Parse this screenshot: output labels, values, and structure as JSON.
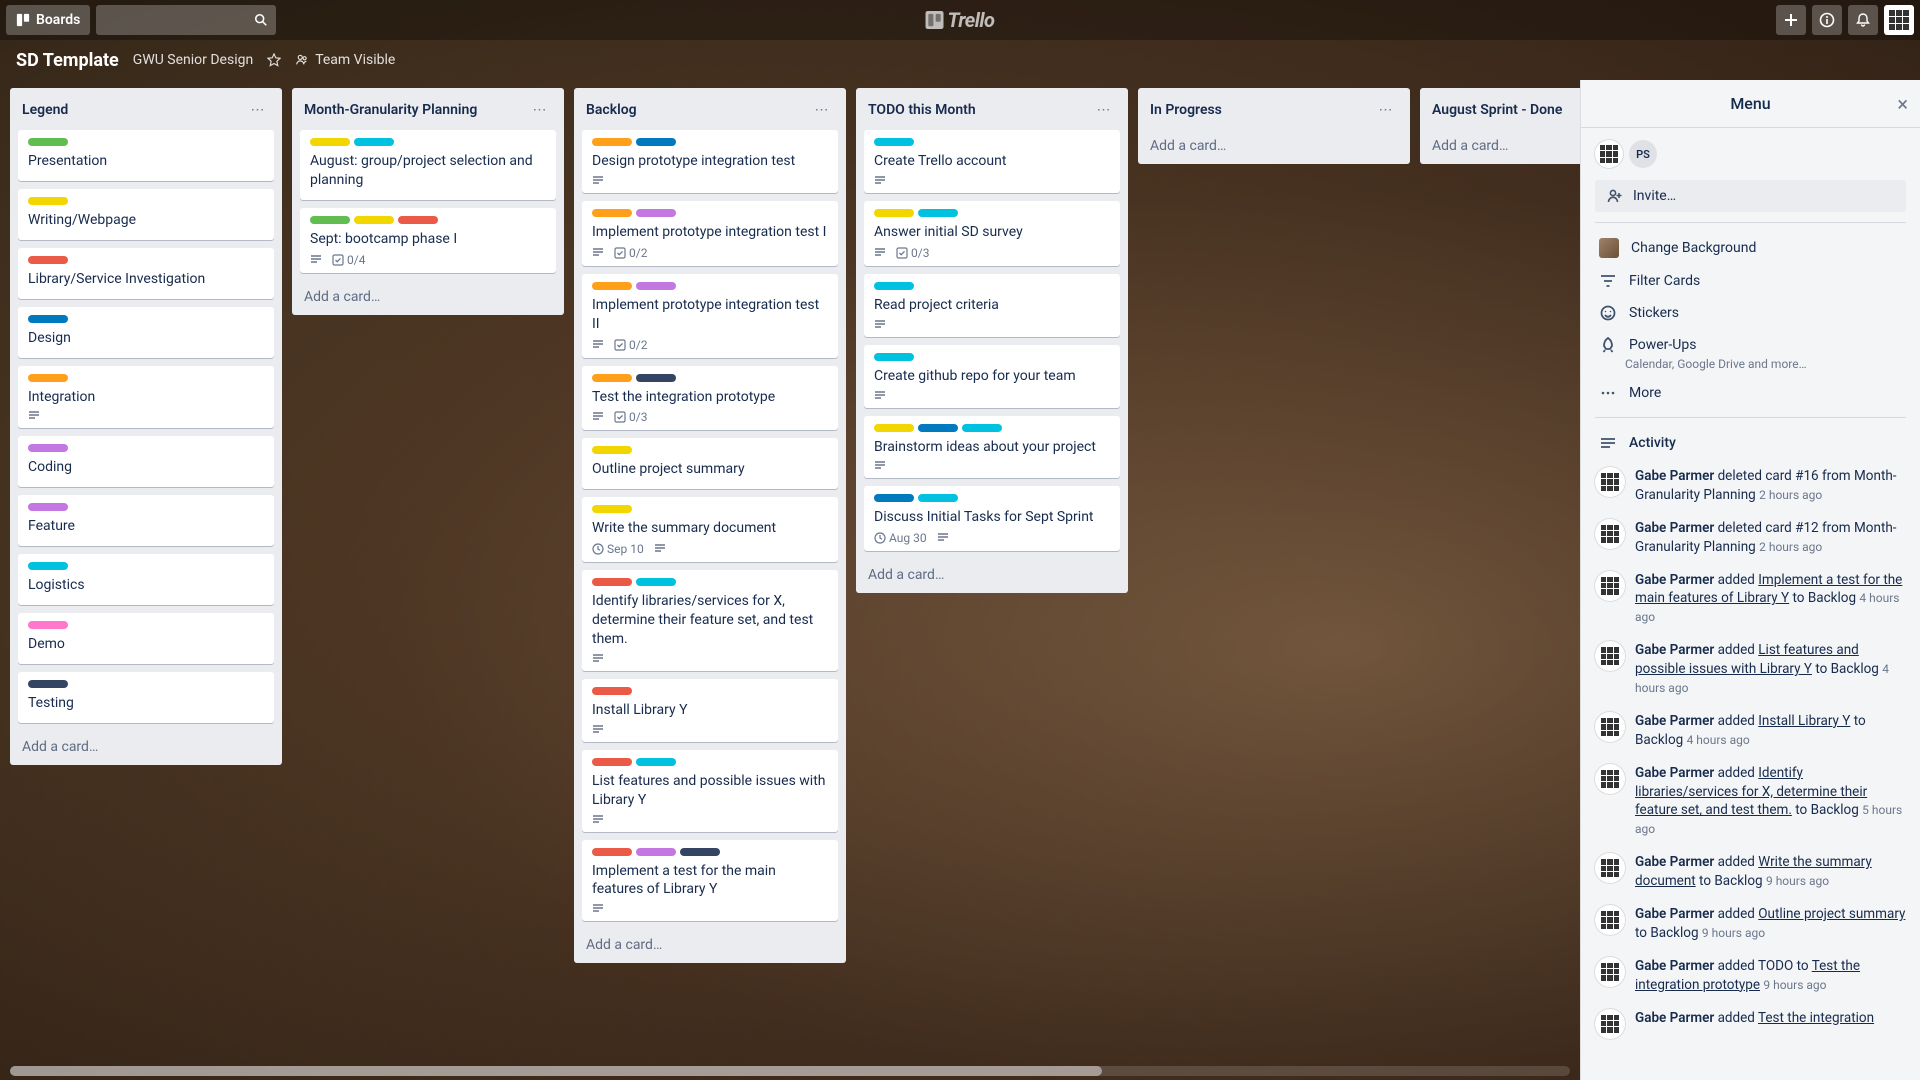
{
  "topbar": {
    "boards": "Boards",
    "logo": "Trello"
  },
  "board": {
    "title": "SD Template",
    "subtitle": "GWU Senior Design",
    "visibility": "Team Visible"
  },
  "addCard": "Add a card…",
  "lists": [
    {
      "title": "Legend",
      "cards": [
        {
          "labels": [
            "green"
          ],
          "title": "Presentation"
        },
        {
          "labels": [
            "yellow"
          ],
          "title": "Writing/Webpage"
        },
        {
          "labels": [
            "red"
          ],
          "title": "Library/Service Investigation"
        },
        {
          "labels": [
            "blue"
          ],
          "title": "Design"
        },
        {
          "labels": [
            "orange"
          ],
          "title": "Integration",
          "desc": true
        },
        {
          "labels": [
            "purple"
          ],
          "title": "Coding"
        },
        {
          "labels": [
            "purple"
          ],
          "title": "Feature"
        },
        {
          "labels": [
            "sky"
          ],
          "title": "Logistics"
        },
        {
          "labels": [
            "pink"
          ],
          "title": "Demo"
        },
        {
          "labels": [
            "black"
          ],
          "title": "Testing"
        }
      ]
    },
    {
      "title": "Month-Granularity Planning",
      "cards": [
        {
          "labels": [
            "yellow",
            "sky"
          ],
          "title": "August: group/project selection and planning"
        },
        {
          "labels": [
            "green",
            "yellow",
            "red"
          ],
          "title": "Sept: bootcamp phase I",
          "desc": true,
          "check": "0/4"
        }
      ]
    },
    {
      "title": "Backlog",
      "cards": [
        {
          "labels": [
            "orange",
            "blue"
          ],
          "title": "Design prototype integration test",
          "desc": true
        },
        {
          "labels": [
            "orange",
            "purple"
          ],
          "title": "Implement prototype integration test I",
          "desc": true,
          "check": "0/2"
        },
        {
          "labels": [
            "orange",
            "purple"
          ],
          "title": "Implement prototype integration test II",
          "desc": true,
          "check": "0/2"
        },
        {
          "labels": [
            "orange",
            "black"
          ],
          "title": "Test the integration prototype",
          "desc": true,
          "check": "0/3"
        },
        {
          "labels": [
            "yellow"
          ],
          "title": "Outline project summary"
        },
        {
          "labels": [
            "yellow"
          ],
          "title": "Write the summary document",
          "date": "Sep 10",
          "desc": true
        },
        {
          "labels": [
            "red",
            "sky"
          ],
          "title": "Identify libraries/services for X, determine their feature set, and test them.",
          "desc": true
        },
        {
          "labels": [
            "red"
          ],
          "title": "Install Library Y",
          "desc": true
        },
        {
          "labels": [
            "red",
            "sky"
          ],
          "title": "List features and possible issues with Library Y",
          "desc": true
        },
        {
          "labels": [
            "red",
            "purple",
            "black"
          ],
          "title": "Implement a test for the main features of Library Y",
          "desc": true
        }
      ]
    },
    {
      "title": "TODO this Month",
      "cards": [
        {
          "labels": [
            "sky"
          ],
          "title": "Create Trello account",
          "desc": true
        },
        {
          "labels": [
            "yellow",
            "sky"
          ],
          "title": "Answer initial SD survey",
          "desc": true,
          "check": "0/3"
        },
        {
          "labels": [
            "sky"
          ],
          "title": "Read project criteria",
          "desc": true
        },
        {
          "labels": [
            "sky"
          ],
          "title": "Create github repo for your team",
          "desc": true
        },
        {
          "labels": [
            "yellow",
            "blue",
            "sky"
          ],
          "title": "Brainstorm ideas about your project",
          "desc": true
        },
        {
          "labels": [
            "blue",
            "sky"
          ],
          "title": "Discuss Initial Tasks for Sept Sprint",
          "date": "Aug 30",
          "desc": true
        }
      ]
    },
    {
      "title": "In Progress",
      "cards": []
    },
    {
      "title": "August Sprint - Done",
      "cards": []
    }
  ],
  "menu": {
    "title": "Menu",
    "ps": "PS",
    "invite": "Invite…",
    "changeBg": "Change Background",
    "filter": "Filter Cards",
    "stickers": "Stickers",
    "powerups": "Power-Ups",
    "powerupsSub": "Calendar, Google Drive and more…",
    "more": "More",
    "activity": "Activity",
    "items": [
      {
        "user": "Gabe Parmer",
        "action": " deleted card #16 from Month-Granularity Planning",
        "time": "2 hours ago"
      },
      {
        "user": "Gabe Parmer",
        "action": " deleted card #12 from Month-Granularity Planning",
        "time": "2 hours ago"
      },
      {
        "user": "Gabe Parmer",
        "action": " added ",
        "link": "Implement a test for the main features of Library Y",
        "tail": " to Backlog",
        "time": "4 hours ago"
      },
      {
        "user": "Gabe Parmer",
        "action": " added ",
        "link": "List features and possible issues with Library Y",
        "tail": " to Backlog",
        "time": "4 hours ago"
      },
      {
        "user": "Gabe Parmer",
        "action": " added ",
        "link": "Install Library Y",
        "tail": " to Backlog",
        "time": "4 hours ago"
      },
      {
        "user": "Gabe Parmer",
        "action": " added ",
        "link": "Identify libraries/services for X, determine their feature set, and test them.",
        "tail": " to Backlog",
        "time": "5 hours ago"
      },
      {
        "user": "Gabe Parmer",
        "action": " added ",
        "link": "Write the summary document",
        "tail": " to Backlog",
        "time": "9 hours ago"
      },
      {
        "user": "Gabe Parmer",
        "action": " added ",
        "link": "Outline project summary",
        "tail": " to Backlog",
        "time": "9 hours ago"
      },
      {
        "user": "Gabe Parmer",
        "action": " added TODO to ",
        "link": "Test the integration prototype",
        "time": "9 hours ago"
      },
      {
        "user": "Gabe Parmer",
        "action": " added ",
        "link": "Test the integration",
        "time": ""
      }
    ]
  }
}
